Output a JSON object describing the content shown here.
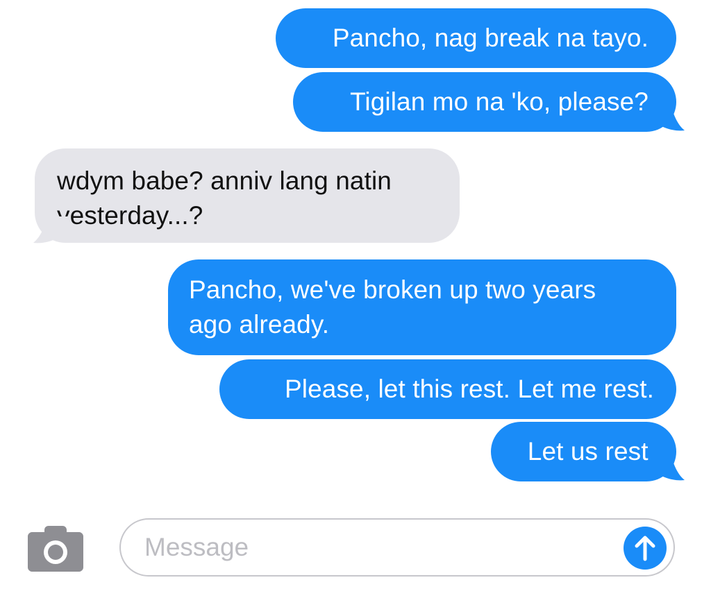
{
  "messages": [
    {
      "direction": "sent",
      "lines": [
        "Pancho, nag break na tayo."
      ]
    },
    {
      "direction": "sent",
      "lines": [
        "Tigilan mo na 'ko, please?"
      ]
    },
    {
      "direction": "received",
      "lines": [
        "wdym babe? anniv lang natin",
        "yesterday...?"
      ]
    },
    {
      "direction": "sent",
      "lines": [
        "Pancho, we've broken up two years",
        "ago already."
      ]
    },
    {
      "direction": "sent",
      "lines": [
        "Please, let this rest. Let me rest."
      ]
    },
    {
      "direction": "sent",
      "lines": [
        "Let us rest."
      ]
    }
  ],
  "composer": {
    "placeholder": "Message",
    "camera_icon": "camera-icon",
    "send_icon": "arrow-up-icon"
  },
  "colors": {
    "sent_bubble": "#1a8cf8",
    "received_bubble": "#e5e5ea",
    "camera": "#8e8e93"
  }
}
